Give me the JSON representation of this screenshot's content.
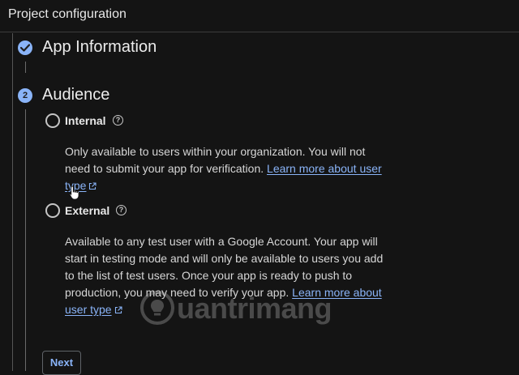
{
  "header": {
    "title": "Project configuration"
  },
  "steps": [
    {
      "title": "App Information",
      "state": "completed",
      "icon": "check-icon"
    },
    {
      "title": "Audience",
      "number": "2",
      "state": "active"
    }
  ],
  "audience": {
    "options": [
      {
        "label": "Internal",
        "help_icon": "help-icon",
        "description": "Only available to users within your organization. You will not need to submit your app for verification.",
        "link_text": "Learn more about user type",
        "selected": false
      },
      {
        "label": "External",
        "help_icon": "help-icon",
        "description": "Available to any test user with a Google Account. Your app will start in testing mode and will only be available to users you add to the list of test users. Once your app is ready to push to production, you may need to verify your app.",
        "link_text": "Learn more about user type",
        "selected": false
      }
    ]
  },
  "actions": {
    "next_label": "Next"
  },
  "watermark": {
    "text": "uantrimang"
  },
  "colors": {
    "background": "#141414",
    "accent": "#8ab4f8",
    "text": "#e3e3e3"
  }
}
